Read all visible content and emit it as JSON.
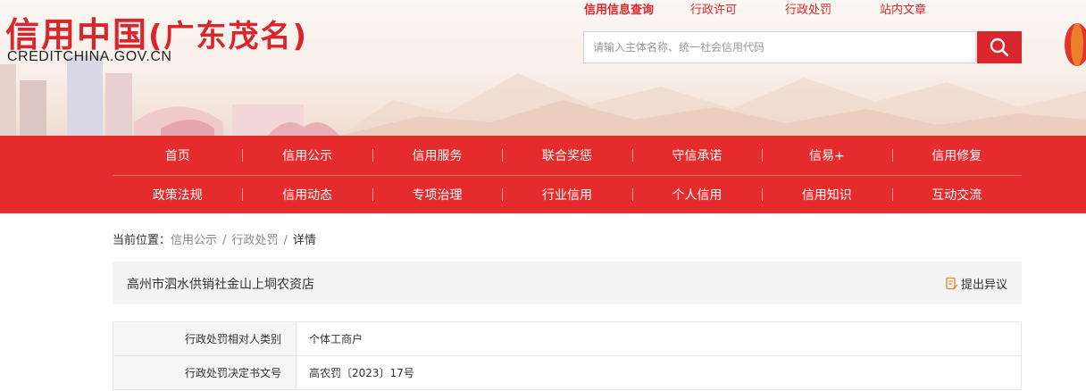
{
  "header": {
    "logo_cn_main": "信用中国",
    "logo_cn_region": "(广东茂名)",
    "logo_en": "CREDITCHINA.GOV.CN",
    "top_links": [
      {
        "label": "信用信息查询",
        "active": true
      },
      {
        "label": "行政许可",
        "active": false
      },
      {
        "label": "行政处罚",
        "active": false
      },
      {
        "label": "站内文章",
        "active": false
      }
    ],
    "search": {
      "placeholder": "请输入主体名称、统一社会信用代码",
      "value": "",
      "button_icon": "search-icon"
    },
    "colors": {
      "brand_red": "#d9262c",
      "nav_red": "#e52b2b"
    }
  },
  "nav": {
    "row1": [
      "首页",
      "信用公示",
      "信用服务",
      "联合奖惩",
      "守信承诺",
      "信易+",
      "信用修复"
    ],
    "row2": [
      "政策法规",
      "信用动态",
      "专项治理",
      "行业信用",
      "个人信用",
      "信用知识",
      "互动交流"
    ]
  },
  "breadcrumb": {
    "prefix": "当前位置：",
    "items": [
      "信用公示",
      "行政处罚",
      "详情"
    ],
    "separator": "/"
  },
  "entity": {
    "name": "高州市泗水供销社金山上垌农资店",
    "objection_label": "提出异议",
    "objection_icon": "document-edit-icon"
  },
  "details": [
    {
      "key": "行政处罚相对人类别",
      "value": "个体工商户"
    },
    {
      "key": "行政处罚决定书文号",
      "value": "高农罚〔2023〕17号"
    }
  ]
}
